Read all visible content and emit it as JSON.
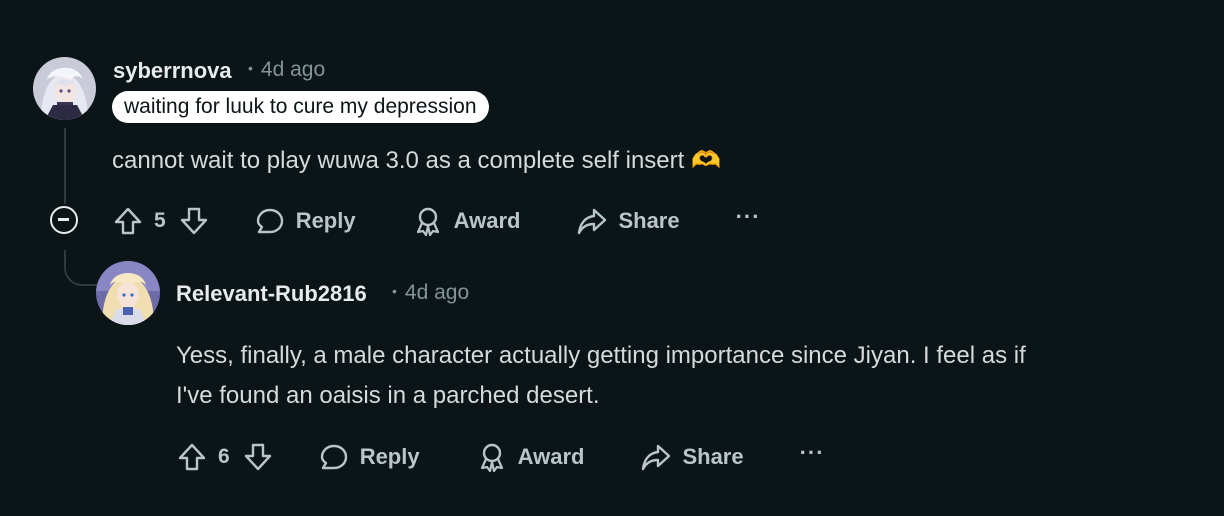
{
  "comments": [
    {
      "username": "syberrnova",
      "time": "4d ago",
      "flair": "waiting for luuk to cure my depression",
      "body": "cannot wait to play wuwa 3.0 as a complete self insert",
      "emoji": "🫶",
      "votes": "5",
      "reply_label": "Reply",
      "award_label": "Award",
      "share_label": "Share",
      "more_label": "···"
    },
    {
      "username": "Relevant-Rub2816",
      "time": "4d ago",
      "body_line1": "Yess, finally, a male character actually getting importance since Jiyan. I feel as if",
      "body_line2": "I've found an oaisis in a parched desert.",
      "votes": "6",
      "reply_label": "Reply",
      "award_label": "Award",
      "share_label": "Share",
      "more_label": "···"
    }
  ],
  "dot": "•",
  "colors": {
    "background": "#0b1416",
    "text": "#d7dadc",
    "meta": "#82959b",
    "action": "#b8c5c9",
    "thread_line": "#2c3c40"
  }
}
